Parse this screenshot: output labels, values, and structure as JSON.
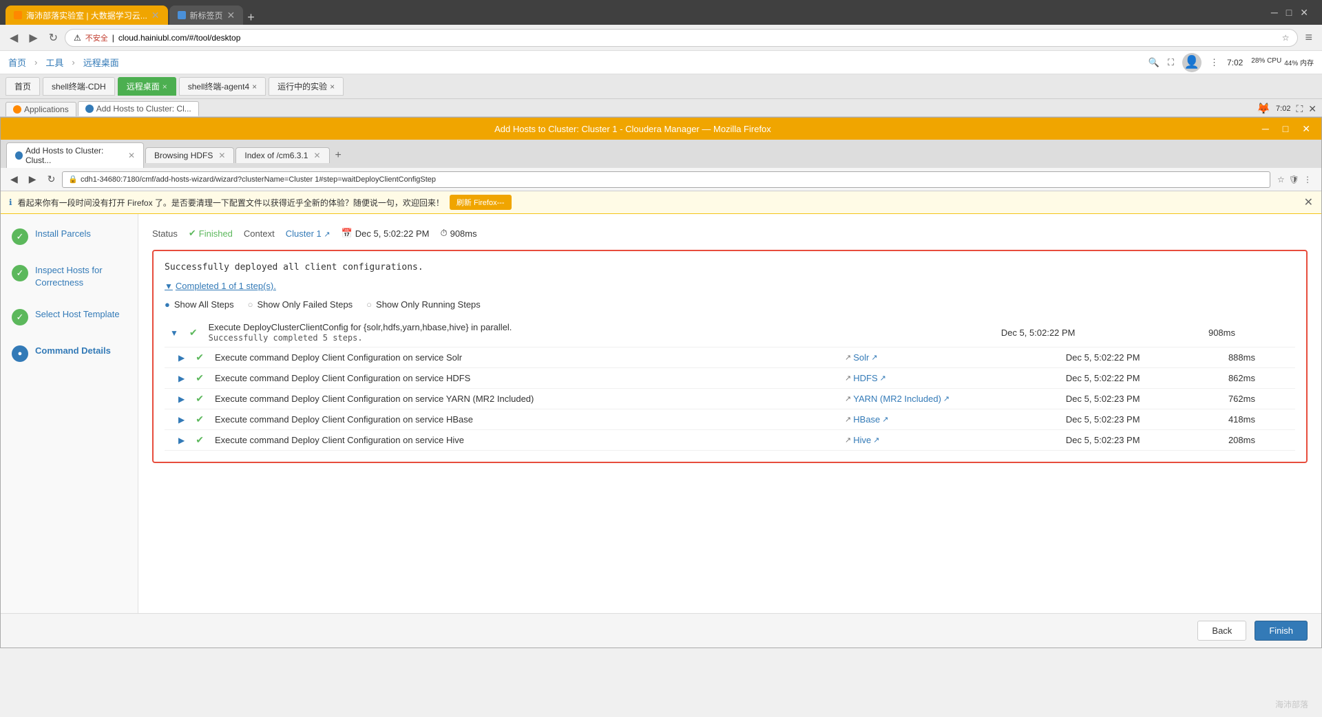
{
  "browser": {
    "title": "海沛部落实验室 | 大数据学习云...",
    "title2": "新标签页",
    "url_outer": "cloud.hainiubl.com/#/tool/desktop",
    "nav_items": [
      "首页",
      "工具",
      "远程桌面"
    ],
    "outer_tabs": [
      "首页",
      "shell终端-CDH",
      "远程桌面",
      "shell终端-agent4",
      "运行中的实验"
    ],
    "app_tabs": [
      "Applications",
      "Add Hosts to Cluster: Cl..."
    ]
  },
  "firefox": {
    "title": "Add Hosts to Cluster: Cluster 1 - Cloudera Manager — Mozilla Firefox",
    "tabs": [
      {
        "label": "Add Hosts to Cluster: Clust...",
        "active": true
      },
      {
        "label": "Browsing HDFS",
        "active": false
      },
      {
        "label": "Index of /cm6.3.1",
        "active": false
      }
    ],
    "url": "cdh1-34680:7180/cmf/add-hosts-wizard/wizard?clusterName=Cluster 1#step=waitDeployClientConfigStep",
    "notification": "看起来你有一段时间没有打开 Firefox 了。是否要清理一下配置文件以获得近乎全新的体验？随便说一句，欢迎回来！",
    "notif_btn": "刷新 Firefox---"
  },
  "wizard": {
    "title": "Add Hosts to Cluster",
    "steps": [
      {
        "label": "Install Parcels",
        "state": "completed"
      },
      {
        "label": "Inspect Hosts for Correctness",
        "state": "completed"
      },
      {
        "label": "Select Host Template",
        "state": "completed"
      },
      {
        "label": "Command Details",
        "state": "active"
      }
    ]
  },
  "status": {
    "label": "Status",
    "finished": "Finished",
    "context_label": "Context",
    "context": "Cluster 1",
    "date_label": "Dec 5, 5:02:22 PM",
    "time_label": "908ms"
  },
  "command": {
    "success_text": "Successfully deployed all client configurations.",
    "completed_text": "Completed 1 of 1 step(s).",
    "filter_all": "Show All Steps",
    "filter_failed": "Show Only Failed Steps",
    "filter_running": "Show Only Running Steps",
    "main_step": {
      "name": "Execute DeployClusterClientConfig for {solr,hdfs,yarn,hbase,hive} in parallel.",
      "sub_text": "Successfully completed 5 steps.",
      "date": "Dec 5, 5:02:22 PM",
      "duration": "908ms"
    },
    "sub_steps": [
      {
        "name": "Execute command Deploy Client Configuration on service Solr",
        "link": "Solr",
        "date": "Dec 5, 5:02:22 PM",
        "duration": "888ms"
      },
      {
        "name": "Execute command Deploy Client Configuration on service HDFS",
        "link": "HDFS",
        "date": "Dec 5, 5:02:22 PM",
        "duration": "862ms"
      },
      {
        "name": "Execute command Deploy Client Configuration on service YARN (MR2 Included)",
        "link": "YARN (MR2 Included)",
        "date": "Dec 5, 5:02:23 PM",
        "duration": "762ms"
      },
      {
        "name": "Execute command Deploy Client Configuration on service HBase",
        "link": "HBase",
        "date": "Dec 5, 5:02:23 PM",
        "duration": "418ms"
      },
      {
        "name": "Execute command Deploy Client Configuration on service Hive",
        "link": "Hive",
        "date": "Dec 5, 5:02:23 PM",
        "duration": "208ms"
      }
    ]
  },
  "footer": {
    "back": "Back",
    "finish": "Finish"
  },
  "colors": {
    "orange": "#f0a500",
    "blue": "#337ab7",
    "green": "#5cb85c",
    "red_border": "#e74c3c"
  }
}
